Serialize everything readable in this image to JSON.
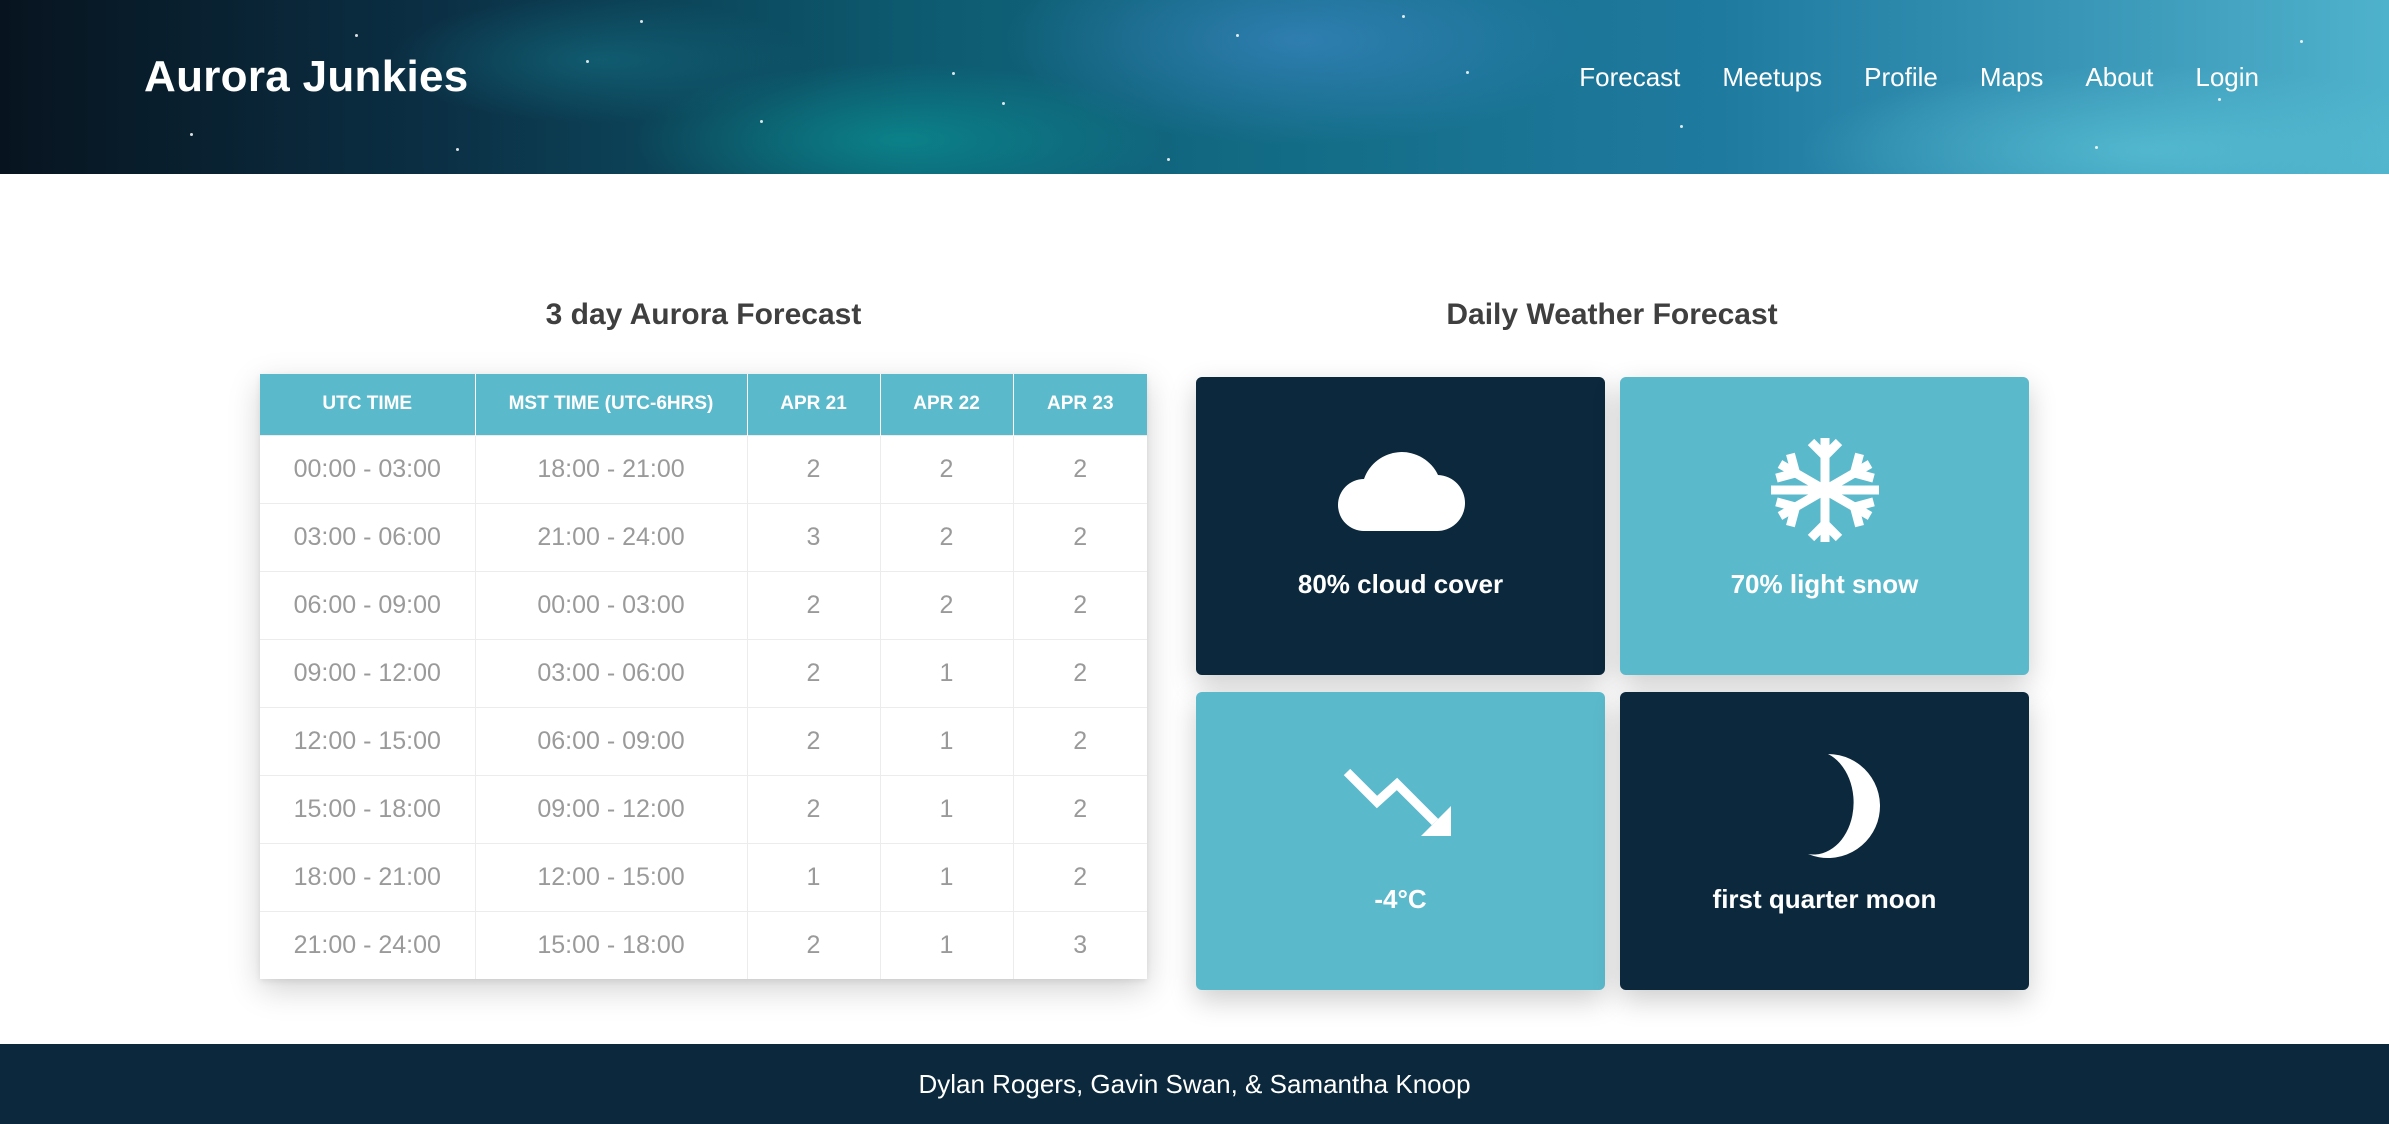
{
  "header": {
    "brand": "Aurora Junkies",
    "nav": [
      "Forecast",
      "Meetups",
      "Profile",
      "Maps",
      "About",
      "Login"
    ]
  },
  "aurora_forecast": {
    "title": "3 day Aurora Forecast",
    "columns": [
      "UTC TIME",
      "MST TIME (UTC-6HRS)",
      "APR 21",
      "APR 22",
      "APR 23"
    ],
    "rows": [
      [
        "00:00 - 03:00",
        "18:00 - 21:00",
        "2",
        "2",
        "2"
      ],
      [
        "03:00 - 06:00",
        "21:00 - 24:00",
        "3",
        "2",
        "2"
      ],
      [
        "06:00 - 09:00",
        "00:00 - 03:00",
        "2",
        "2",
        "2"
      ],
      [
        "09:00 - 12:00",
        "03:00 - 06:00",
        "2",
        "1",
        "2"
      ],
      [
        "12:00 - 15:00",
        "06:00 - 09:00",
        "2",
        "1",
        "2"
      ],
      [
        "15:00 - 18:00",
        "09:00 - 12:00",
        "2",
        "1",
        "2"
      ],
      [
        "18:00 - 21:00",
        "12:00 - 15:00",
        "1",
        "1",
        "2"
      ],
      [
        "21:00 - 24:00",
        "15:00 - 18:00",
        "2",
        "1",
        "3"
      ]
    ]
  },
  "weather": {
    "title": "Daily Weather Forecast",
    "cards": [
      {
        "label": "80% cloud cover",
        "icon": "cloud-icon",
        "color": "#0b283c"
      },
      {
        "label": "70% light snow",
        "icon": "snowflake-icon",
        "color": "#5bb9cc"
      },
      {
        "label": "-4°C",
        "icon": "trend-down-icon",
        "color": "#5bb9cc"
      },
      {
        "label": "first quarter moon",
        "icon": "moon-icon",
        "color": "#0b283c"
      }
    ]
  },
  "footer": {
    "credits": "Dylan Rogers, Gavin Swan, & Samantha Knoop"
  },
  "colors": {
    "accent": "#5bb9cc",
    "dark": "#0b283c"
  }
}
